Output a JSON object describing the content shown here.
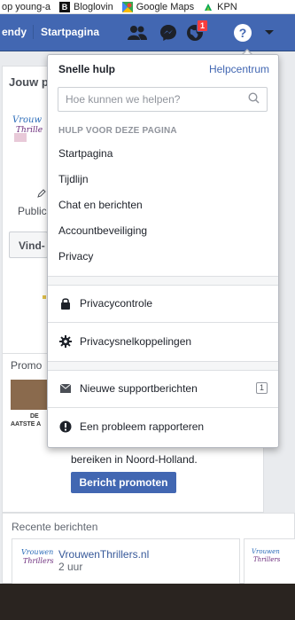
{
  "bookmarks": {
    "items": [
      {
        "label": "op young-a"
      },
      {
        "label": "Bloglovin",
        "icon": "bloglovin-b-icon"
      },
      {
        "label": "Google Maps",
        "icon": "google-maps-icon"
      },
      {
        "label": "KPN",
        "icon": "kpn-icon"
      }
    ]
  },
  "fbbar": {
    "partial_name": "endy",
    "home_label": "Startpagina",
    "notification_count": "1",
    "colors": {
      "bar": "#4267b2",
      "badge": "#fa3e3e"
    }
  },
  "background": {
    "jouw_label": "Jouw p",
    "public_label": "Public",
    "vind_label": "Vind-",
    "promo_label": "Promo",
    "promo_image_text": "DE",
    "promo_image_text2": "AATSTE A",
    "body_text": "bereiken in Noord-Holland.",
    "promote_button": "Bericht promoten",
    "recent_heading": "Recente berichten",
    "post_title": "VrouwenThrillers.nl",
    "post_time": "2 uur",
    "logo_text_1": "Vrouwen",
    "logo_text_2": "Thrillers",
    "logo_text_partial_1": "Vrouw",
    "logo_text_partial_2": "Thrille"
  },
  "dropdown": {
    "title": "Snelle hulp",
    "help_center": "Helpcentrum",
    "search_placeholder": "Hoe kunnen we helpen?",
    "section_heading": "HULP VOOR DEZE PAGINA",
    "links": [
      "Startpagina",
      "Tijdlijn",
      "Chat en berichten",
      "Accountbeveiliging",
      "Privacy"
    ],
    "privacy_check": "Privacycontrole",
    "privacy_shortcuts": "Privacysnelkoppelingen",
    "support_messages": "Nieuwe supportberichten",
    "support_count": "1",
    "report_problem": "Een probleem rapporteren"
  }
}
